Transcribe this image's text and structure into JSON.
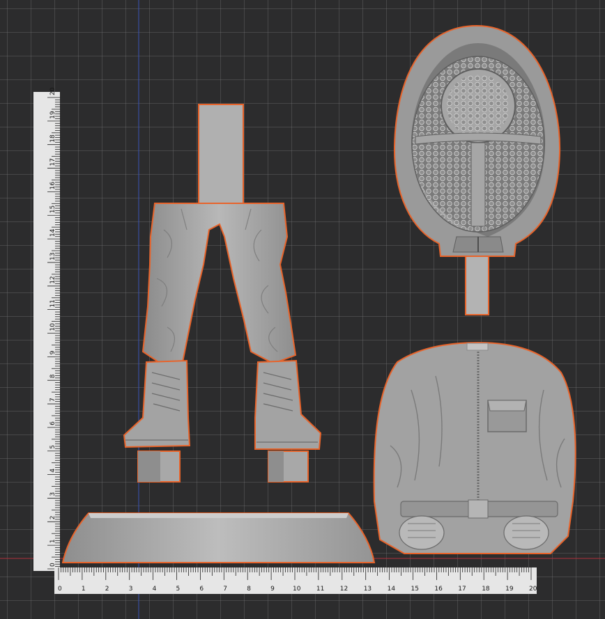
{
  "colors": {
    "background": "#2c2c2d",
    "grid": "#6e6e72",
    "selection_outline": "#e8632a",
    "model": "#a9a9a9",
    "ruler": "#e6e6e6",
    "axis_x": "#b0303a",
    "axis_y": "#3a55b8"
  },
  "viewport": {
    "grid": true,
    "scale_unit": "cm",
    "vertical_ruler": {
      "labels": [
        "0",
        "1",
        "2",
        "3",
        "4",
        "5",
        "6",
        "7",
        "8",
        "9",
        "10",
        "11",
        "12",
        "13",
        "14",
        "15",
        "16",
        "17",
        "18",
        "19",
        "20"
      ]
    },
    "horizontal_ruler": {
      "labels": [
        "0",
        "1",
        "2",
        "3",
        "4",
        "5",
        "6",
        "7",
        "8",
        "9",
        "10",
        "11",
        "12",
        "13",
        "14",
        "15",
        "16",
        "17",
        "18",
        "19",
        "20"
      ]
    }
  },
  "parts": [
    {
      "name": "legs-with-boots",
      "icon": "legs-icon",
      "selected": true
    },
    {
      "name": "masked-head-with-hood",
      "icon": "head-icon",
      "selected": true
    },
    {
      "name": "jacket-torso-with-hands",
      "icon": "torso-icon",
      "selected": true
    },
    {
      "name": "round-base",
      "icon": "base-icon",
      "selected": true
    }
  ]
}
